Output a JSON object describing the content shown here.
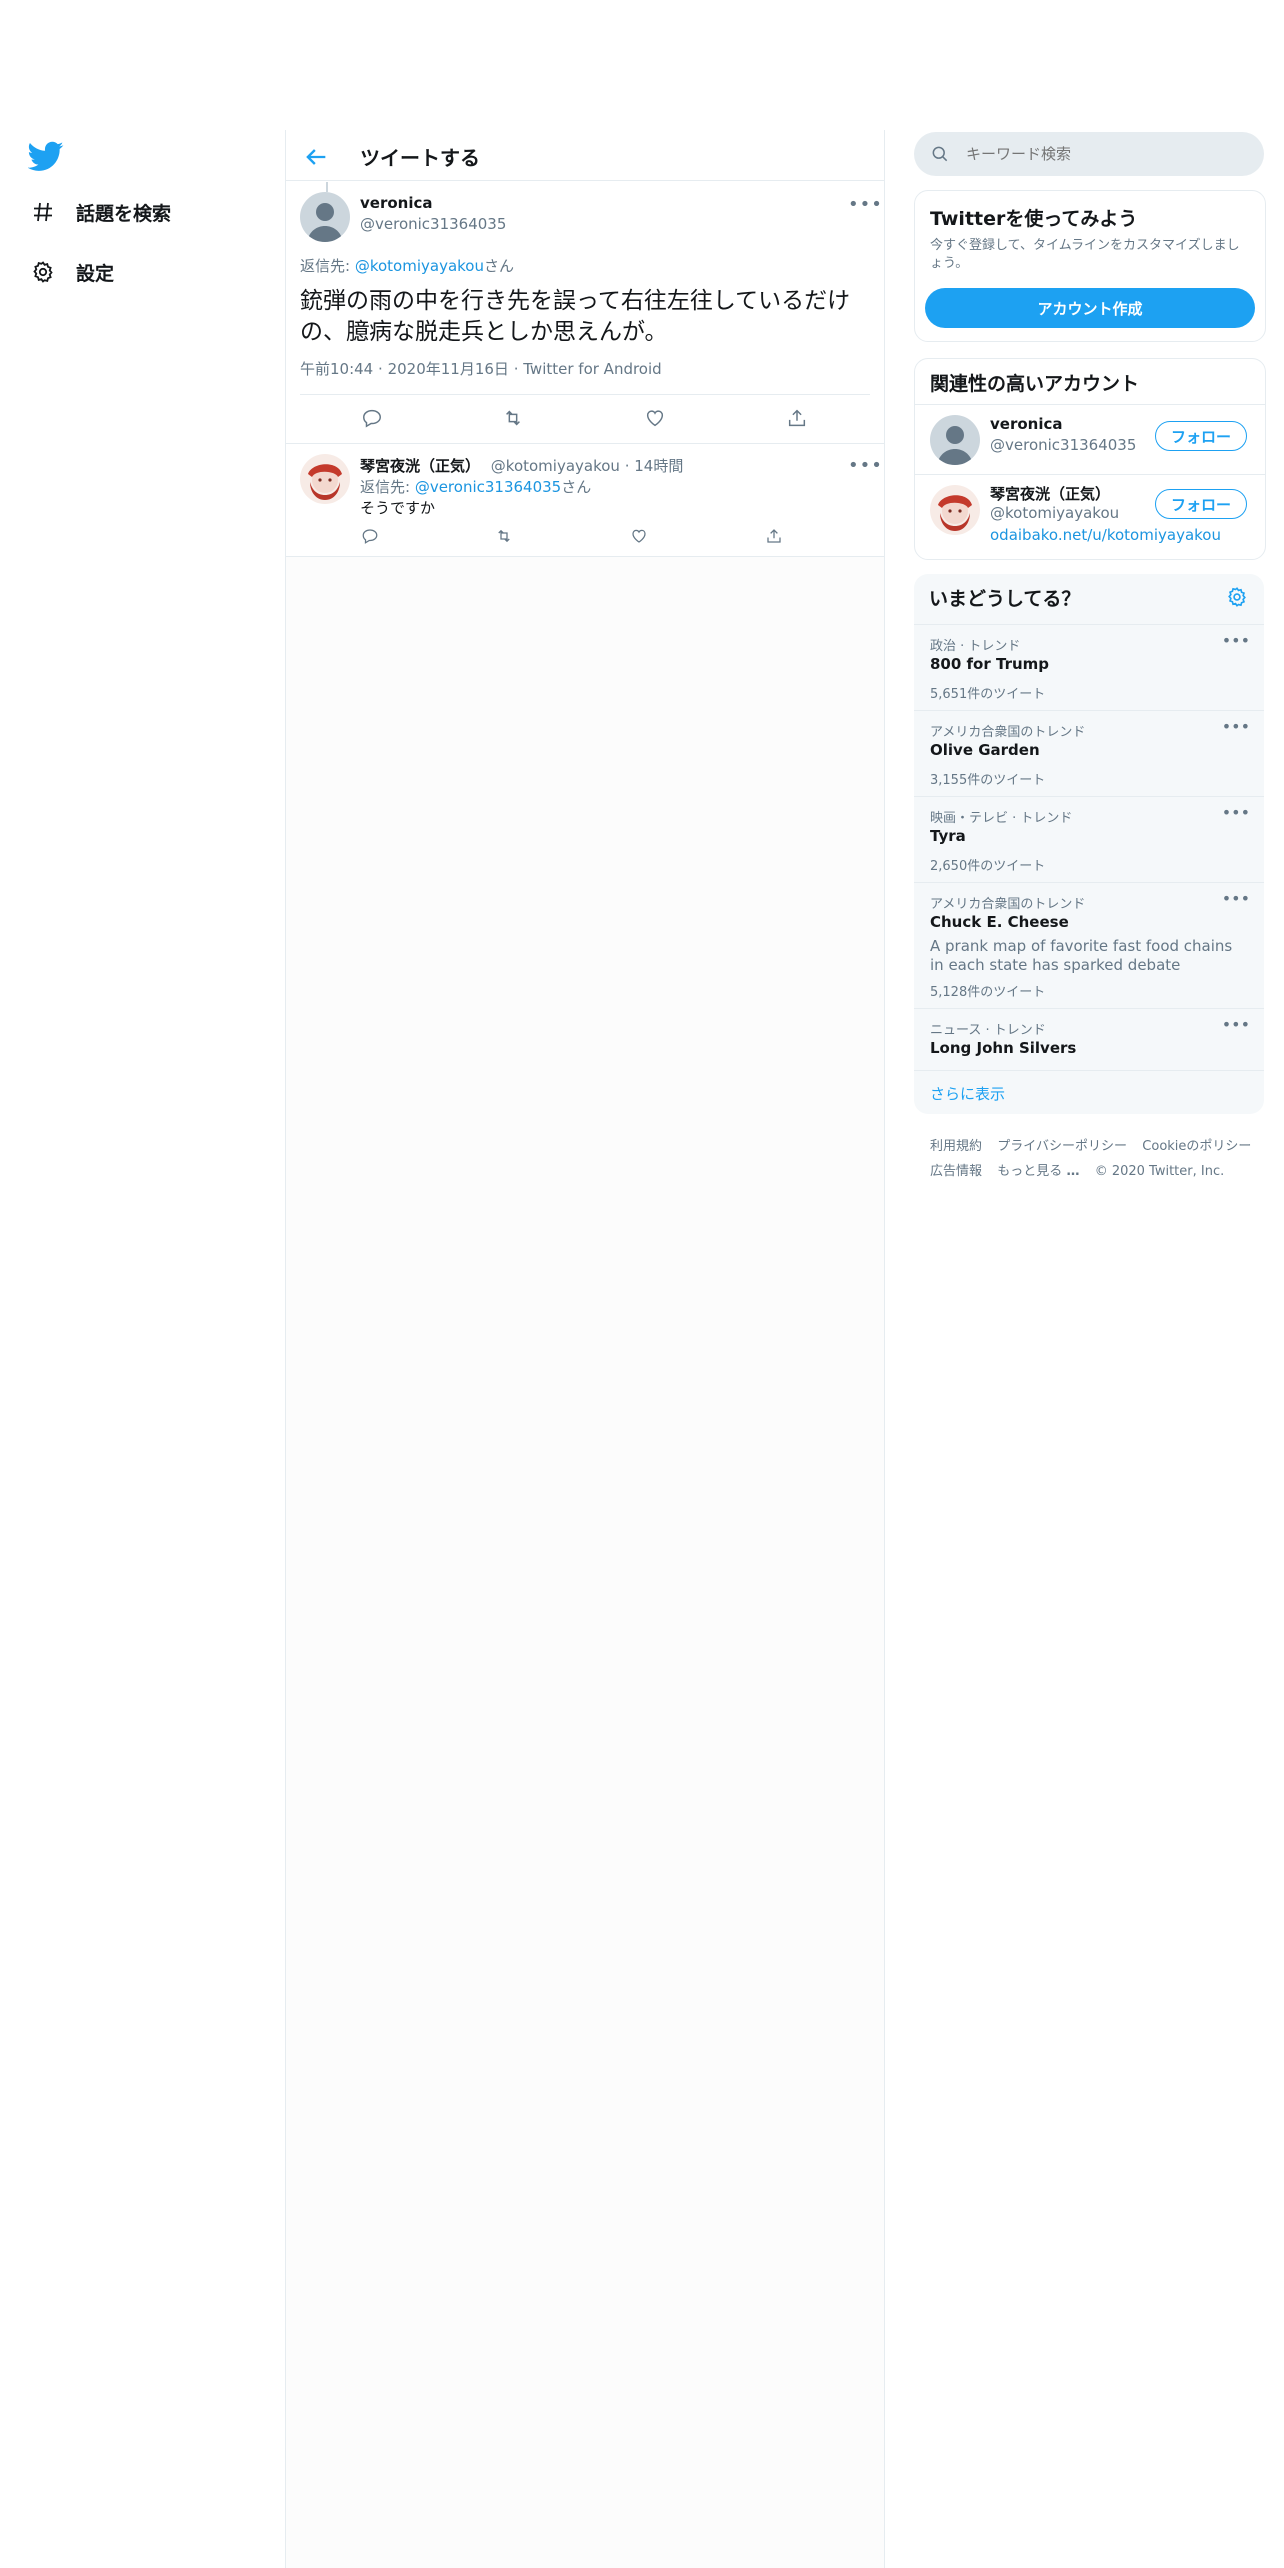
{
  "brand": {
    "accent": "#1da1f2",
    "link": "#1b95e0",
    "muted": "#657786",
    "icon_logo": "twitter-bird-icon"
  },
  "nav": {
    "items": [
      {
        "label": "話題を検索",
        "icon": "hashtag-icon"
      },
      {
        "label": "設定",
        "icon": "gear-icon"
      }
    ]
  },
  "main": {
    "header_title": "ツイートする",
    "tweet": {
      "name": "veronica",
      "handle": "@veronic31364035",
      "reply_prefix": "返信先: ",
      "reply_to": "@kotomiyayakou",
      "reply_suffix": "さん",
      "text": "銃弾の雨の中を行き先を誤って右往左往しているだけの、臆病な脱走兵としか思えんが。",
      "time": "午前10:44",
      "date": "2020年11月16日",
      "source": "Twitter for Android",
      "more": "•••"
    },
    "reply": {
      "name": "琴宮夜洸（正気）",
      "handle": "@kotomiyayakou",
      "time_ago": "14時間",
      "reply_prefix": "返信先: ",
      "reply_to": "@veronic31364035",
      "reply_suffix": "さん",
      "text": "そうですか",
      "more": "•••"
    }
  },
  "sidebar": {
    "search_placeholder": "キーワード検索",
    "signup": {
      "title": "Twitterを使ってみよう",
      "desc": "今すぐ登録して、タイムラインをカスタマイズしましょう。",
      "button": "アカウント作成"
    },
    "related": {
      "title": "関連性の高いアカウント",
      "accounts": [
        {
          "name": "veronica",
          "handle": "@veronic31364035",
          "follow": "フォロー"
        },
        {
          "name": "琴宮夜洸（正気）",
          "handle": "@kotomiyayakou",
          "url": "odaibako.net/u/kotomiyayakou",
          "follow": "フォロー"
        }
      ]
    },
    "trends": {
      "title": "いまどうしてる？",
      "items": [
        {
          "category": "政治 · トレンド",
          "name": "800 for Trump",
          "count": "5,651件のツイート"
        },
        {
          "category": "アメリカ合衆国のトレンド",
          "name": "Olive Garden",
          "count": "3,155件のツイート"
        },
        {
          "category": "映画・テレビ · トレンド",
          "name": "Tyra",
          "count": "2,650件のツイート"
        },
        {
          "category": "アメリカ合衆国のトレンド",
          "name": "Chuck E. Cheese",
          "desc": "A prank map of favorite fast food chains in each state has sparked debate",
          "count": "5,128件のツイート"
        },
        {
          "category": "ニュース · トレンド",
          "name": "Long John Silvers"
        }
      ],
      "show_more": "さらに表示"
    },
    "footer": {
      "links": [
        "利用規約",
        "プライバシーポリシー",
        "Cookieのポリシー",
        "広告情報",
        "もっと見る"
      ],
      "more_dots": "…",
      "copyright": "© 2020 Twitter, Inc."
    }
  }
}
